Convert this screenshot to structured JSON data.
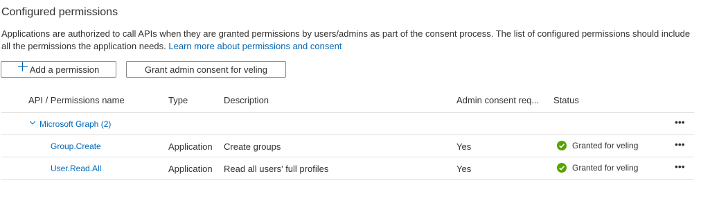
{
  "section": {
    "title": "Configured permissions",
    "description_text": "Applications are authorized to call APIs when they are granted permissions by users/admins as part of the consent process. The list of configured permissions should include all the permissions the application needs. ",
    "learn_more_link": "Learn more about permissions and consent"
  },
  "toolbar": {
    "add_label": "Add a permission",
    "grant_label": "Grant admin consent for veling"
  },
  "table": {
    "headers": {
      "api": "API / Permissions name",
      "type": "Type",
      "description": "Description",
      "admin": "Admin consent req...",
      "status": "Status"
    },
    "group": {
      "label": "Microsoft Graph (2)",
      "more": "•••"
    },
    "rows": [
      {
        "name": "Group.Create",
        "type": "Application",
        "description": "Create groups",
        "admin": "Yes",
        "status": "Granted for veling",
        "more": "•••"
      },
      {
        "name": "User.Read.All",
        "type": "Application",
        "description": "Read all users' full profiles",
        "admin": "Yes",
        "status": "Granted for veling",
        "more": "•••"
      }
    ]
  },
  "icons": {
    "plus": "plus-icon",
    "chevron": "chevron-down-icon",
    "status_ok": "check-circle-icon",
    "more": "more-horizontal-icon"
  },
  "colors": {
    "link": "#0067b8",
    "success": "#57a300",
    "border": "#e1dfdd"
  }
}
